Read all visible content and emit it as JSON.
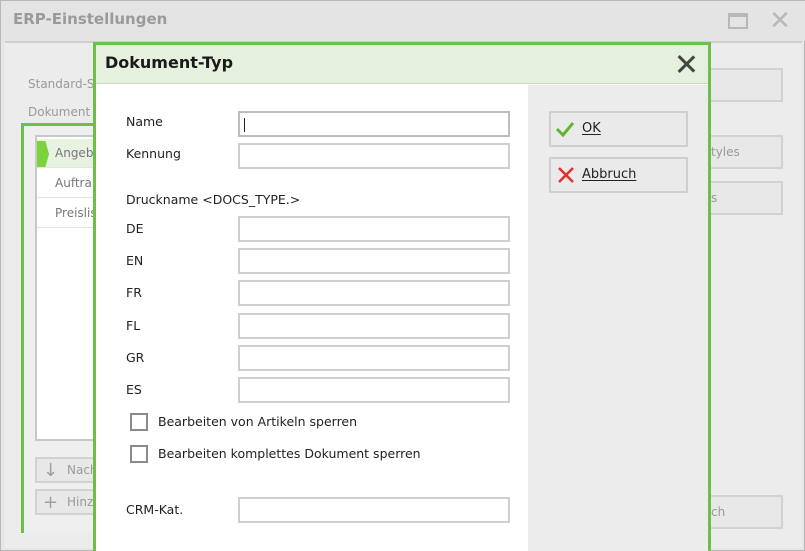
{
  "background_window": {
    "title": "ERP-Einstellungen",
    "labels": {
      "standard": "Standard-S",
      "dokument": "Dokument"
    },
    "list_items": [
      "Angebo",
      "Auftra",
      "Preislis"
    ],
    "buttons": {
      "nach": "Nach",
      "hinzu": "Hinz",
      "styles": "tyles",
      "s": "s",
      "ch": "ch"
    }
  },
  "dialog": {
    "title": "Dokument-Typ",
    "fields": {
      "name_label": "Name",
      "name_value": "",
      "kennung_label": "Kennung",
      "kennung_value": "",
      "druckname_heading": "Druckname <DOCS_TYPE.>",
      "de_label": "DE",
      "en_label": "EN",
      "fr_label": "FR",
      "fl_label": "FL",
      "gr_label": "GR",
      "es_label": "ES",
      "crm_label": "CRM-Kat."
    },
    "checkboxes": {
      "lock_articles": "Bearbeiten von Artikeln sperren",
      "lock_document": "Bearbeiten komplettes Dokument sperren"
    },
    "buttons": {
      "ok": "OK",
      "cancel": "Abbruch"
    }
  },
  "colors": {
    "accent_green": "#6cc04a",
    "header_bg": "#e5f0dd",
    "cancel_red": "#e03030"
  }
}
